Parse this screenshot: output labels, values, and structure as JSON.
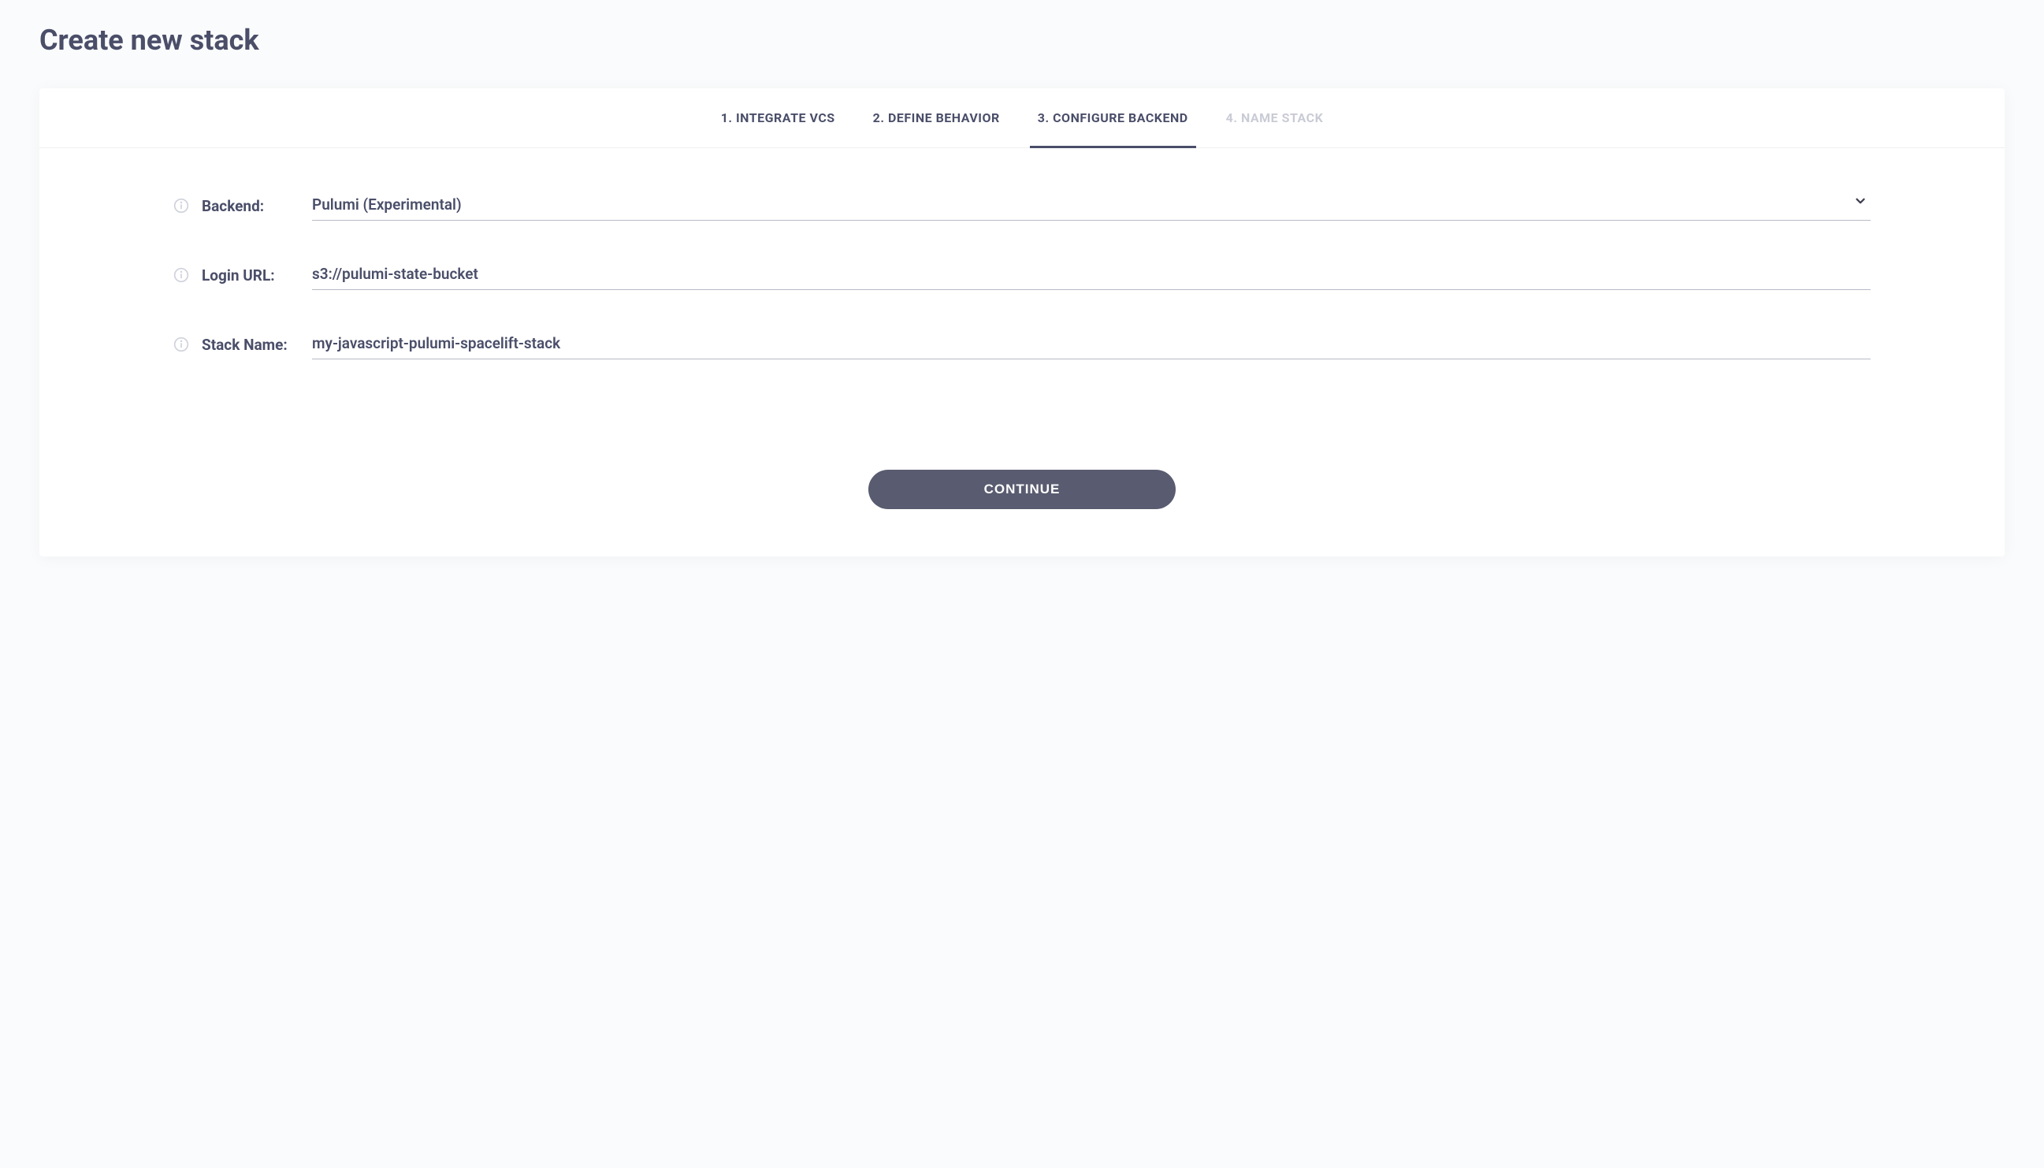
{
  "page": {
    "title": "Create new stack"
  },
  "tabs": {
    "t0": "1. INTEGRATE VCS",
    "t1": "2. DEFINE BEHAVIOR",
    "t2": "3. CONFIGURE BACKEND",
    "t3": "4. NAME STACK"
  },
  "form": {
    "backend": {
      "label": "Backend:",
      "value": "Pulumi (Experimental)"
    },
    "loginUrl": {
      "label": "Login URL:",
      "value": "s3://pulumi-state-bucket"
    },
    "stackName": {
      "label": "Stack Name:",
      "value": "my-javascript-pulumi-spacelift-stack"
    }
  },
  "buttons": {
    "continue": "CONTINUE"
  }
}
